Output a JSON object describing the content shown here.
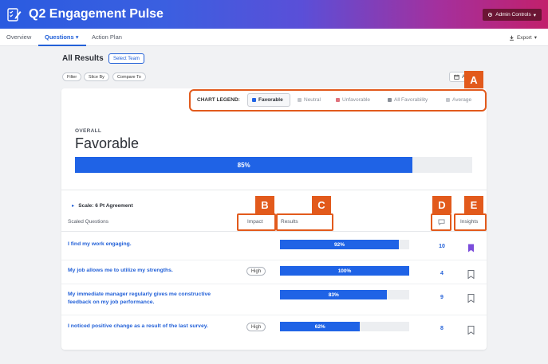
{
  "app": {
    "title": "Q2 Engagement Pulse",
    "admin_label": "Admin Controls"
  },
  "nav": {
    "tabs": [
      "Overview",
      "Questions",
      "Action Plan"
    ],
    "export_label": "Export"
  },
  "toolbar": {
    "section_title": "All Results",
    "select_team": "Select Team",
    "filters": [
      "Filter",
      "Slice By",
      "Compare To"
    ],
    "date_label": "A"
  },
  "legend": {
    "label": "CHART LEGEND:",
    "items": [
      {
        "name": "Favorable",
        "color": "#1f63e6"
      },
      {
        "name": "Neutral",
        "color": "#c4c7cc"
      },
      {
        "name": "Unfavorable",
        "color": "#e0727c"
      },
      {
        "name": "All Favorability",
        "color": "#8a8f98"
      },
      {
        "name": "Average",
        "color": "#c4c7cc"
      }
    ]
  },
  "badges": {
    "a": "A",
    "b": "B",
    "c": "C",
    "d": "D",
    "e": "E"
  },
  "overall": {
    "label": "OVERALL",
    "value": "Favorable",
    "percent_label": "85%",
    "percent": 85
  },
  "table": {
    "scale_label": "Scale: 6 Pt Agreement",
    "headers": {
      "questions": "Scaled Questions",
      "impact": "Impact",
      "results": "Results",
      "insights": "Insights"
    },
    "rows": [
      {
        "question": "I find my work engaging.",
        "impact": "",
        "result_label": "92%",
        "result": 92,
        "comments": "10",
        "bookmarked": true
      },
      {
        "question": "My job allows me to utilize my strengths.",
        "impact": "High",
        "result_label": "100%",
        "result": 100,
        "comments": "4",
        "bookmarked": false
      },
      {
        "question": "My immediate manager regularly gives me constructive feedback on my job performance.",
        "impact": "",
        "result_label": "83%",
        "result": 83,
        "comments": "9",
        "bookmarked": false
      },
      {
        "question": "I noticed positive change as a result of the last survey.",
        "impact": "High",
        "result_label": "62%",
        "result": 62,
        "comments": "8",
        "bookmarked": false
      }
    ]
  },
  "colors": {
    "accent": "#2361d8",
    "bar": "#1f63e6",
    "annotation": "#e25a1c",
    "bookmark_active": "#7b4ddb"
  }
}
